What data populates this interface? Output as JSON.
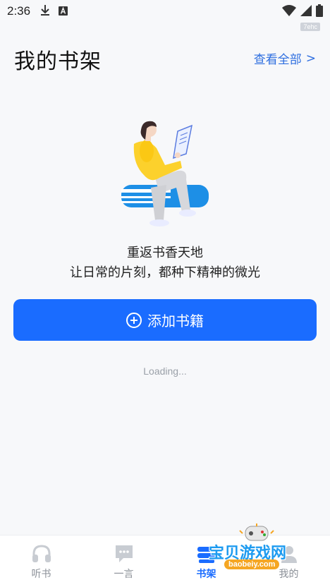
{
  "status_bar": {
    "time": "2:36",
    "icons": [
      "download-icon",
      "a-box-icon",
      "wifi-icon",
      "signal-icon",
      "battery-icon"
    ]
  },
  "watermark_tag": "7ehc",
  "header": {
    "title": "我的书架",
    "view_all_label": "查看全部",
    "view_all_chevron": ">"
  },
  "empty_state": {
    "illustration": "woman-reading-on-books-illustration",
    "title": "重返书香天地",
    "subtitle": "让日常的片刻，都种下精神的微光"
  },
  "add_button": {
    "label": "添加书籍",
    "icon": "plus-circle-icon"
  },
  "loading_text": "Loading...",
  "bottom_nav": {
    "items": [
      {
        "label": "听书",
        "icon": "headphones-icon",
        "active": false
      },
      {
        "label": "一言",
        "icon": "chat-bubble-icon",
        "active": false
      },
      {
        "label": "书架",
        "icon": "bookshelf-icon",
        "active": true
      },
      {
        "label": "我的",
        "icon": "profile-icon",
        "active": false
      }
    ]
  },
  "colors": {
    "accent": "#1a6cff",
    "link": "#2f6fe0",
    "background": "#f7f8fa"
  },
  "logo_watermark": {
    "text": "宝贝游戏网",
    "url": "baobeiy.com"
  }
}
